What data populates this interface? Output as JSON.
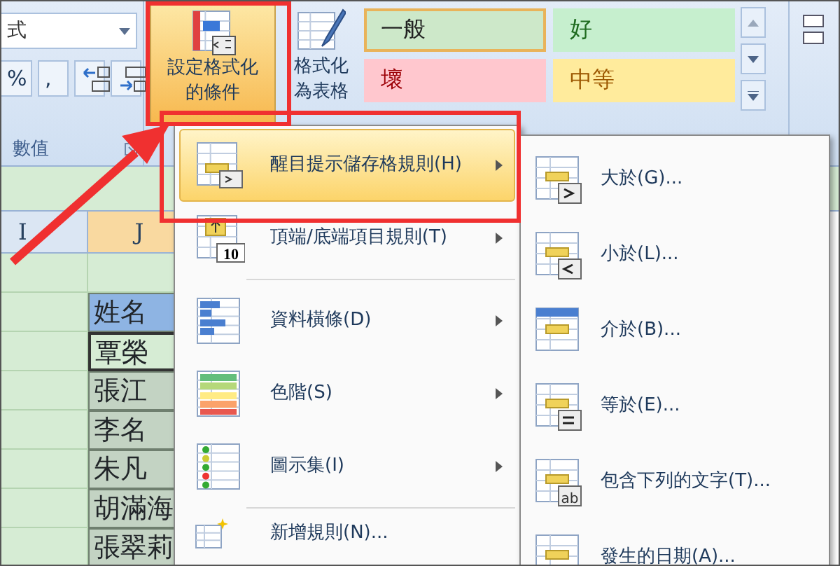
{
  "ribbon": {
    "format_dropdown": {
      "value": "式"
    },
    "number_buttons": [
      {
        "kind": "percent",
        "label": "%"
      },
      {
        "kind": "comma",
        "label": ","
      },
      {
        "kind": "increase-decimal"
      },
      {
        "kind": "decrease-decimal"
      }
    ],
    "number_group_label": "數值",
    "cf_button": {
      "label": "設定格式化的條件",
      "pressed": true
    },
    "table_button": {
      "label": "格式化為表格"
    },
    "cell_styles": [
      {
        "label": "一般",
        "kind": "normal",
        "selected": true
      },
      {
        "label": "好",
        "kind": "good",
        "selected": false
      },
      {
        "label": "壞",
        "kind": "bad",
        "selected": false
      },
      {
        "label": "中等",
        "kind": "neutral",
        "selected": false
      }
    ]
  },
  "sheet": {
    "columns": [
      {
        "label": "I",
        "selected": false
      },
      {
        "label": "J",
        "selected": true
      }
    ],
    "cells": [
      {
        "text": "姓名",
        "kind": "header",
        "selected": false
      },
      {
        "text": "覃榮",
        "kind": "data",
        "selected": true
      },
      {
        "text": "張江",
        "kind": "data",
        "selected": false
      },
      {
        "text": "李名",
        "kind": "data",
        "selected": false
      },
      {
        "text": "朱凡",
        "kind": "data",
        "selected": false
      },
      {
        "text": "胡滿海",
        "kind": "data",
        "selected": false
      },
      {
        "text": "張翠莉",
        "kind": "data",
        "selected": false
      }
    ]
  },
  "menu": {
    "items": [
      {
        "label": "醒目提示儲存格規則(H)",
        "kind": "highlight",
        "selected": true,
        "submenu": true
      },
      {
        "label": "頂端/底端項目規則(T)",
        "kind": "topbottom",
        "badge": "10",
        "selected": false,
        "submenu": true
      },
      {
        "label": "資料橫條(D)",
        "kind": "databar",
        "selected": false,
        "submenu": true
      },
      {
        "label": "色階(S)",
        "kind": "colorscale",
        "selected": false,
        "submenu": true
      },
      {
        "label": "圖示集(I)",
        "kind": "iconset",
        "selected": false,
        "submenu": true
      },
      {
        "label": "新增規則(N)...",
        "kind": "newrule",
        "selected": false,
        "submenu": false
      }
    ]
  },
  "submenu": {
    "items": [
      {
        "label": "大於(G)...",
        "kind": "greater"
      },
      {
        "label": "小於(L)...",
        "kind": "less"
      },
      {
        "label": "介於(B)...",
        "kind": "between"
      },
      {
        "label": "等於(E)...",
        "kind": "equal"
      },
      {
        "label": "包含下列的文字(T)...",
        "kind": "text",
        "badge": "ab"
      },
      {
        "label": "發生的日期(A)...",
        "kind": "date"
      }
    ]
  }
}
